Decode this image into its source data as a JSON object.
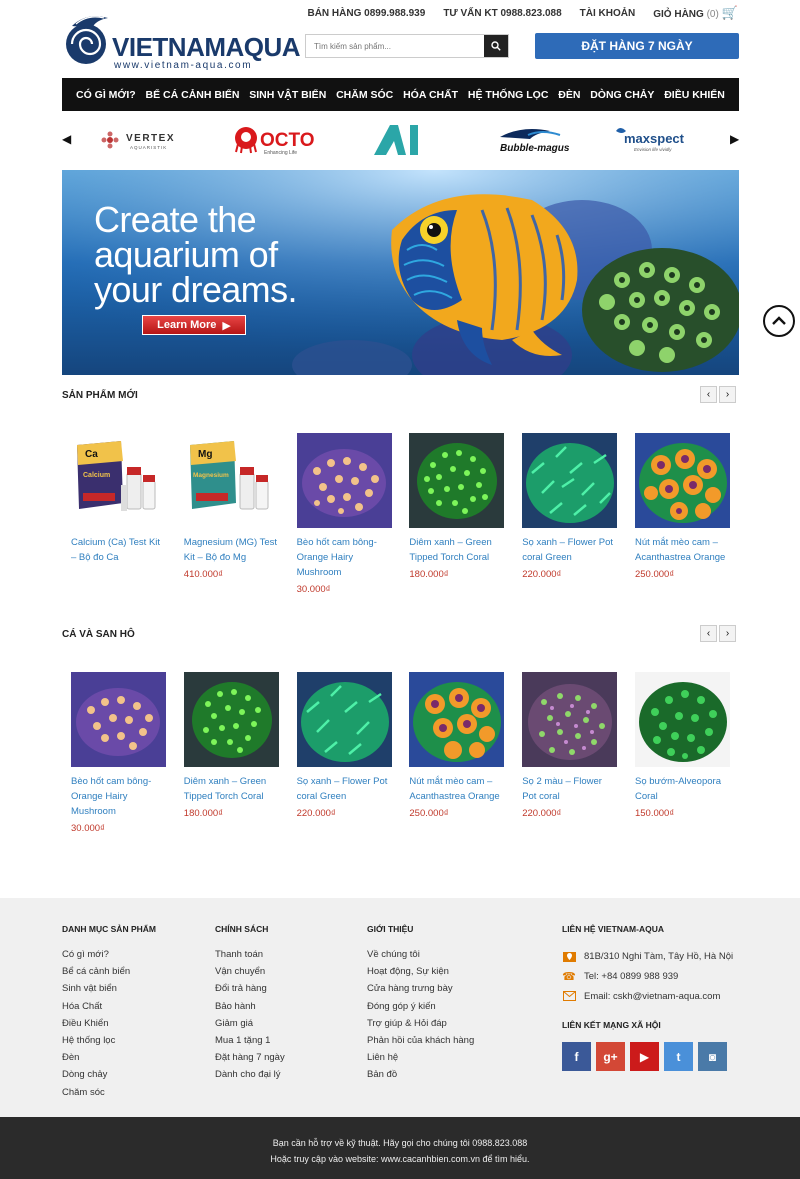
{
  "topbar": {
    "sales": "BÁN HÀNG 0899.988.939",
    "tech": "TƯ VẤN KT 0988.823.088",
    "account": "TÀI KHOẢN",
    "cart": "GIỎ HÀNG",
    "cart_count": "(0)"
  },
  "logo": {
    "name_a": "VIETNAM",
    "name_b": "AQUA",
    "url": "www.vietnam-aqua.com"
  },
  "search": {
    "placeholder": "Tìm kiếm sản phẩm..."
  },
  "order_button": "ĐẶT HÀNG 7 NGÀY",
  "nav": [
    "CÓ GÌ MỚI?",
    "BỂ CÁ CẢNH BIỂN",
    "SINH VẬT BIỂN",
    "CHĂM SÓC",
    "HÓA CHẤT",
    "HỆ THỐNG LỌC",
    "ĐÈN",
    "DÒNG CHẢY",
    "ĐIỀU KHIỂN"
  ],
  "brands": {
    "vertex": "VERTEX",
    "vertex_sub": "AQUARISTIK",
    "octo": "OCTO",
    "octo_sub": "Enhancing Life",
    "ai": "AI",
    "bubble": "Bubble-magus",
    "maxspect": "maxspect",
    "maxspect_sub": "Envision life vividly"
  },
  "banner": {
    "line1": "Create the",
    "line2": "aquarium of",
    "line3": "your dreams.",
    "button": "Learn More"
  },
  "sections": {
    "new": {
      "title": "SẢN PHẨM MỚI",
      "items": [
        {
          "name": "Calcium (Ca) Test Kit – Bộ đo Ca",
          "price": "",
          "kit": "Ca",
          "kit_label": "Calcium"
        },
        {
          "name": "Magnesium (MG) Test Kit – Bộ đo Mg",
          "price": "410.000₫",
          "kit": "Mg",
          "kit_label": "Magnesium"
        },
        {
          "name": "Bèo hốt cam bông-Orange Hairy Mushroom",
          "price": "30.000₫"
        },
        {
          "name": "Diêm xanh – Green Tipped Torch Coral",
          "price": "180.000₫"
        },
        {
          "name": "Sọ xanh – Flower Pot coral Green",
          "price": "220.000₫"
        },
        {
          "name": "Nút mắt mèo cam – Acanthastrea Orange",
          "price": "250.000₫"
        }
      ]
    },
    "coral": {
      "title": "CÁ VÀ SAN HÔ",
      "items": [
        {
          "name": "Bèo hốt cam bông-Orange Hairy Mushroom",
          "price": "30.000₫"
        },
        {
          "name": "Diêm xanh – Green Tipped Torch Coral",
          "price": "180.000₫"
        },
        {
          "name": "Sọ xanh – Flower Pot coral Green",
          "price": "220.000₫"
        },
        {
          "name": "Nút mắt mèo cam – Acanthastrea Orange",
          "price": "250.000₫"
        },
        {
          "name": "Sọ 2 màu – Flower Pot coral",
          "price": "220.000₫"
        },
        {
          "name": "Sọ bướm-Alveopora Coral",
          "price": "150.000₫"
        }
      ]
    }
  },
  "footer": {
    "col1": {
      "title": "DANH MỤC SẢN PHẨM",
      "links": [
        "Có gì mới?",
        "Bể cá cảnh biển",
        "Sinh vật biển",
        "Hóa Chất",
        "Điều Khiển",
        "Hệ thống lọc",
        "Đèn",
        "Dòng chảy",
        "Chăm sóc"
      ]
    },
    "col2": {
      "title": "CHÍNH SÁCH",
      "links": [
        "Thanh toán",
        "Vận chuyển",
        "Đổi trả hàng",
        "Bảo hành",
        "Giảm giá",
        "Mua 1 tặng 1",
        "Đặt hàng 7 ngày",
        "Dành cho đại lý"
      ]
    },
    "col3": {
      "title": "GIỚI THIỆU",
      "links": [
        "Về chúng tôi",
        "Hoạt động, Sự kiện",
        "Cửa hàng trưng bày",
        "Đóng góp ý kiến",
        "Trợ giúp & Hỏi đáp",
        "Phản hồi của khách hàng",
        "Liên hệ",
        "Bản đồ"
      ]
    },
    "contact": {
      "title": "LIÊN HỆ VIETNAM-AQUA",
      "address": "81B/310 Nghi Tàm, Tây Hồ, Hà Nội",
      "tel": "Tel: +84 0899 988 939",
      "email": "Email: cskh@vietnam-aqua.com"
    },
    "social": {
      "title": "LIÊN KẾT MẠNG XÃ HỘI",
      "fb": "f",
      "gp": "g+",
      "yt": "▶",
      "tw": "t",
      "ig": "◙"
    }
  },
  "bottom": {
    "line1": "Bạn cần hỗ trợ về kỹ thuật. Hãy gọi cho chúng tôi 0988.823.088",
    "line2": "Hoặc truy cập vào website: www.cacanhbien.com.vn để tìm hiểu."
  },
  "colors": {
    "accent": "#2e6bb8",
    "price": "#c0392b",
    "link": "#2f7fbf",
    "nav": "#111111",
    "footer_bg": "#f0f0f0",
    "bottom_bg": "#2b2b2b"
  }
}
